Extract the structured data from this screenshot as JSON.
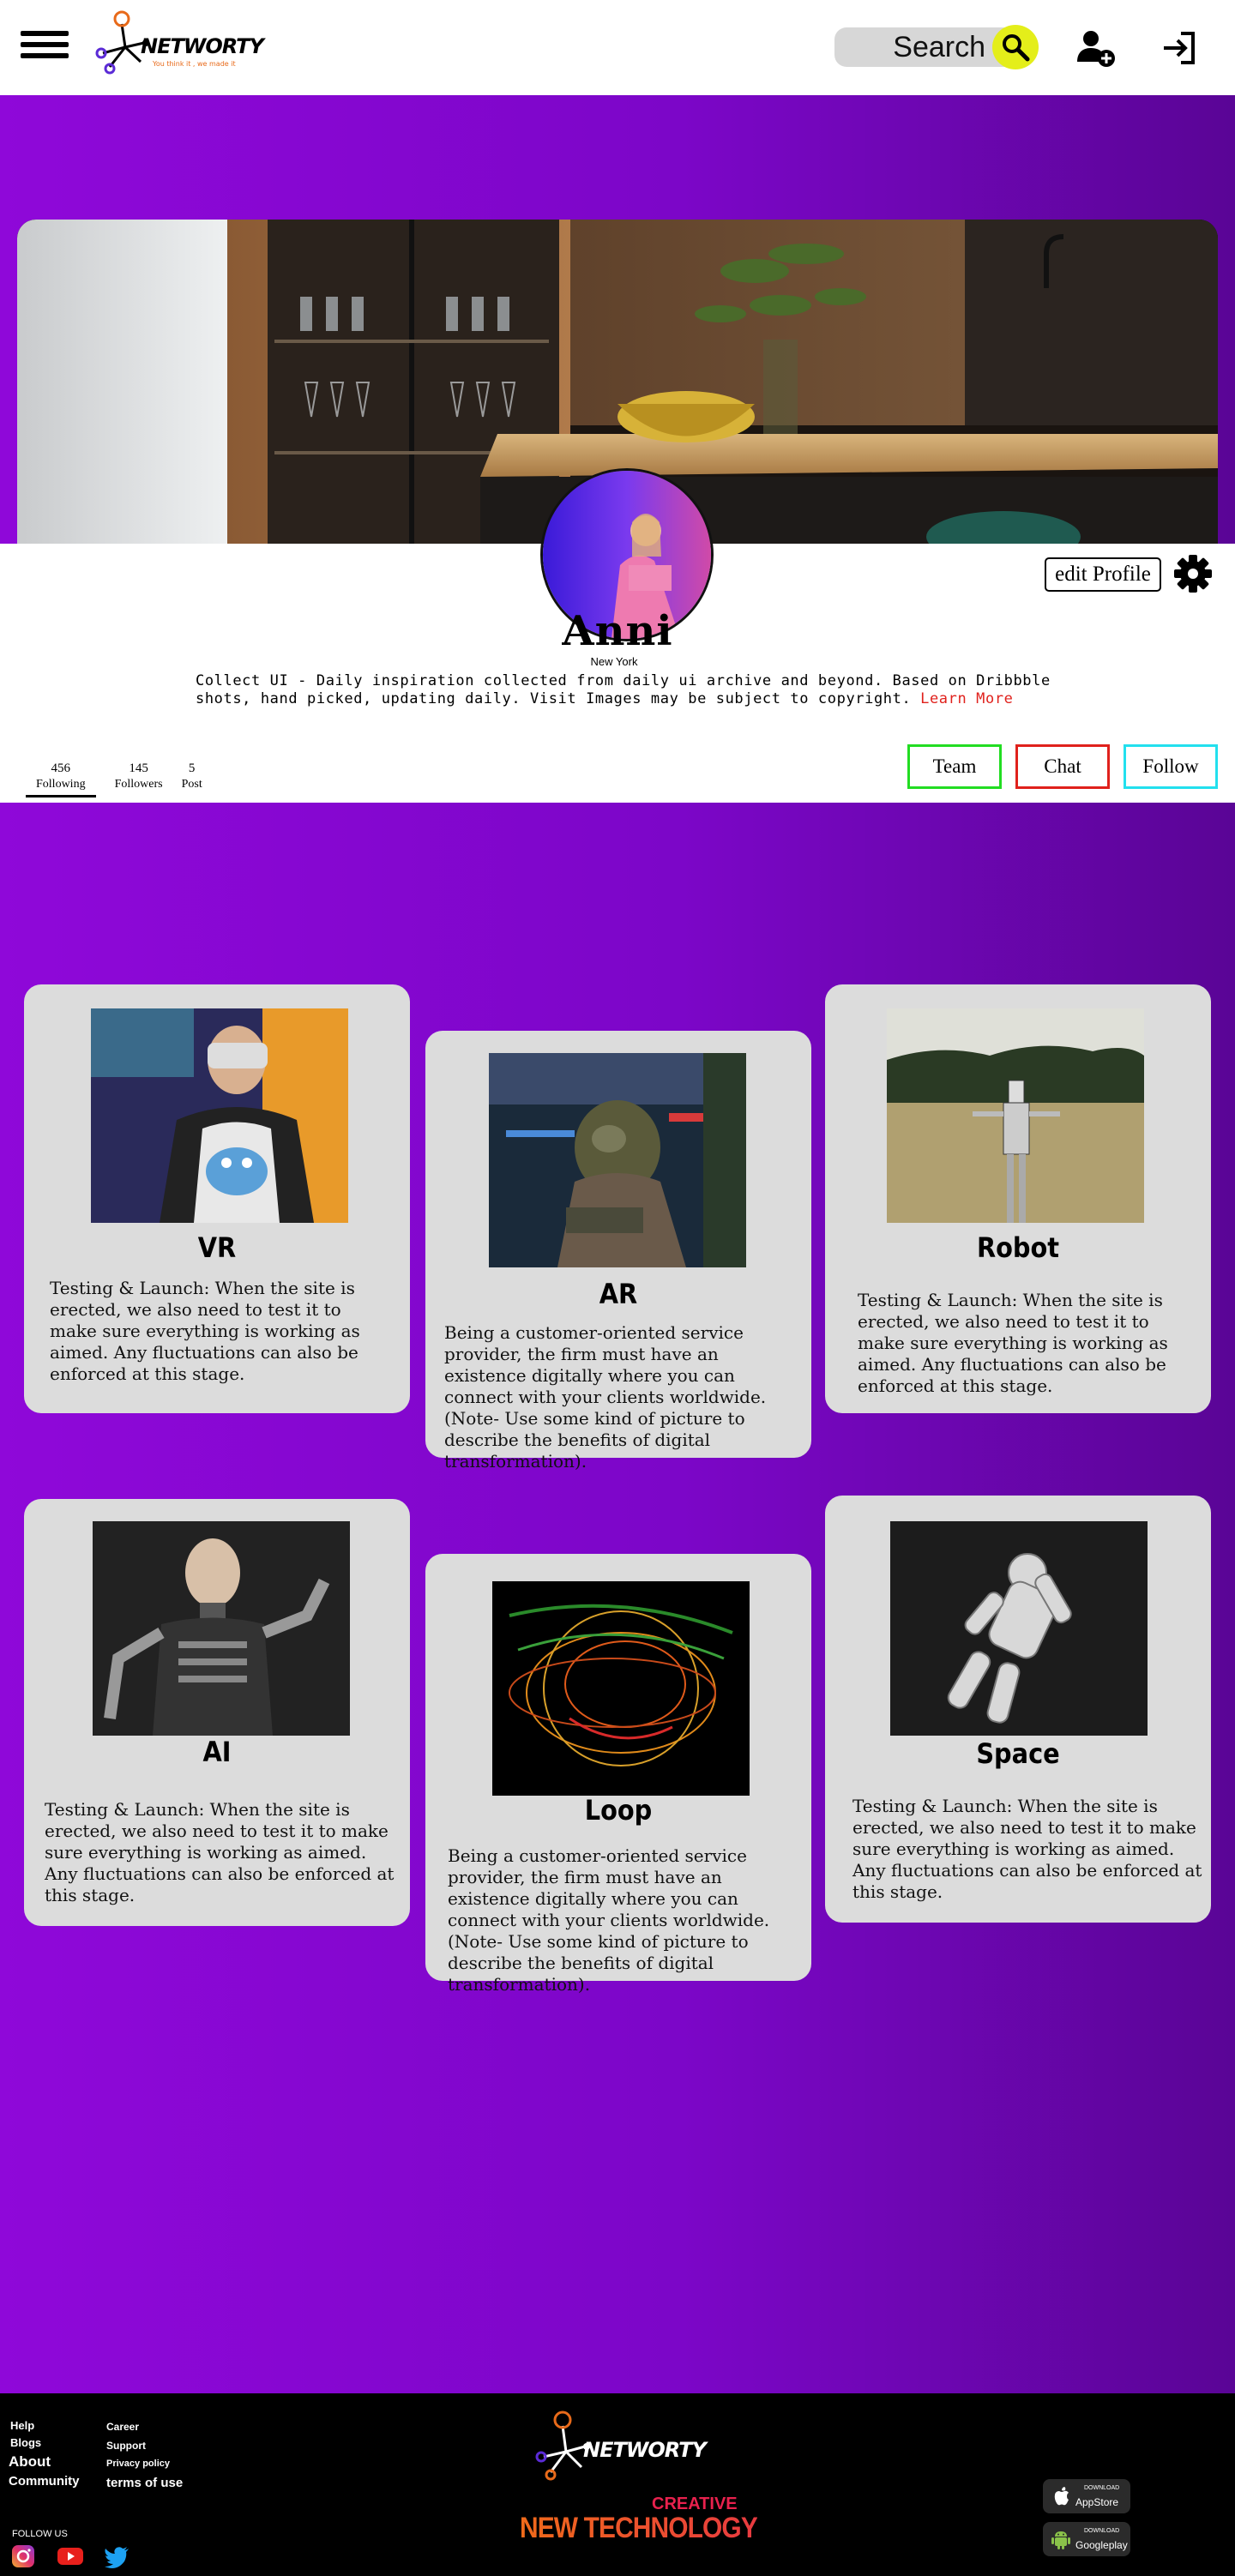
{
  "header": {
    "brand": "NETWORTY",
    "tagline": "You think it , we made it",
    "search_placeholder": "Search"
  },
  "profile": {
    "name": "Anni",
    "location": "New York",
    "bio": "Collect UI - Daily inspiration collected from daily ui archive and beyond. Based on Dribbble shots, hand picked, updating daily.  Visit Images may be subject to copyright.",
    "learn_more": "Learn More",
    "edit_label": "edit Profile",
    "stats": [
      {
        "num": "456",
        "label": "Following"
      },
      {
        "num": "145",
        "label": "Followers"
      },
      {
        "num": "5",
        "label": "Post"
      }
    ],
    "buttons": {
      "team": "Team",
      "chat": "Chat",
      "follow": "Follow"
    }
  },
  "cards": [
    {
      "title": "VR",
      "text": "Testing & Launch: When the site is erected, we also need to test it to make sure everything is working as aimed. Any fluctuations can also be enforced at this stage."
    },
    {
      "title": "AR",
      "text": "Being a customer-oriented service provider, the firm must have an existence digitally where you can connect with your clients worldwide. (Note- Use some kind of picture to describe the benefits of digital transformation)."
    },
    {
      "title": "Robot",
      "text": "Testing & Launch: When the site is erected, we also need to test it to make sure everything is working as aimed. Any fluctuations can also be enforced at this stage."
    },
    {
      "title": "AI",
      "text": "Testing & Launch: When the site is erected, we also need to test it to make sure everything is working as aimed. Any fluctuations can also be enforced at this stage."
    },
    {
      "title": "Loop",
      "text": "Being a customer-oriented service provider, the firm must have an existence digitally where you can connect with your clients worldwide. (Note- Use some kind of picture to describe the benefits of digital transformation)."
    },
    {
      "title": "Space",
      "text": "Testing & Launch: When the site is erected, we also need to test it to make sure everything is working as aimed. Any fluctuations can also be enforced at this stage."
    }
  ],
  "footer": {
    "links_col1": [
      "Help",
      "Blogs",
      "About",
      "Community"
    ],
    "links_col2": [
      "Career",
      "Support",
      "Privacy policy",
      "terms of use"
    ],
    "follow_us": "FOLLOW US",
    "brand": "NETWORTY",
    "creative": "CREATIVE",
    "new_technology": "NEW TECHNOLOGY",
    "appstore": {
      "small": "DOWNLOAD",
      "name": "AppStore"
    },
    "googleplay": {
      "small": "DOWNLOAD",
      "name": "Googleplay"
    }
  },
  "colors": {
    "team_border": "#22dd22",
    "chat_border": "#e0211c",
    "follow_border": "#22e0ee",
    "search_button": "#e4ee1a"
  }
}
